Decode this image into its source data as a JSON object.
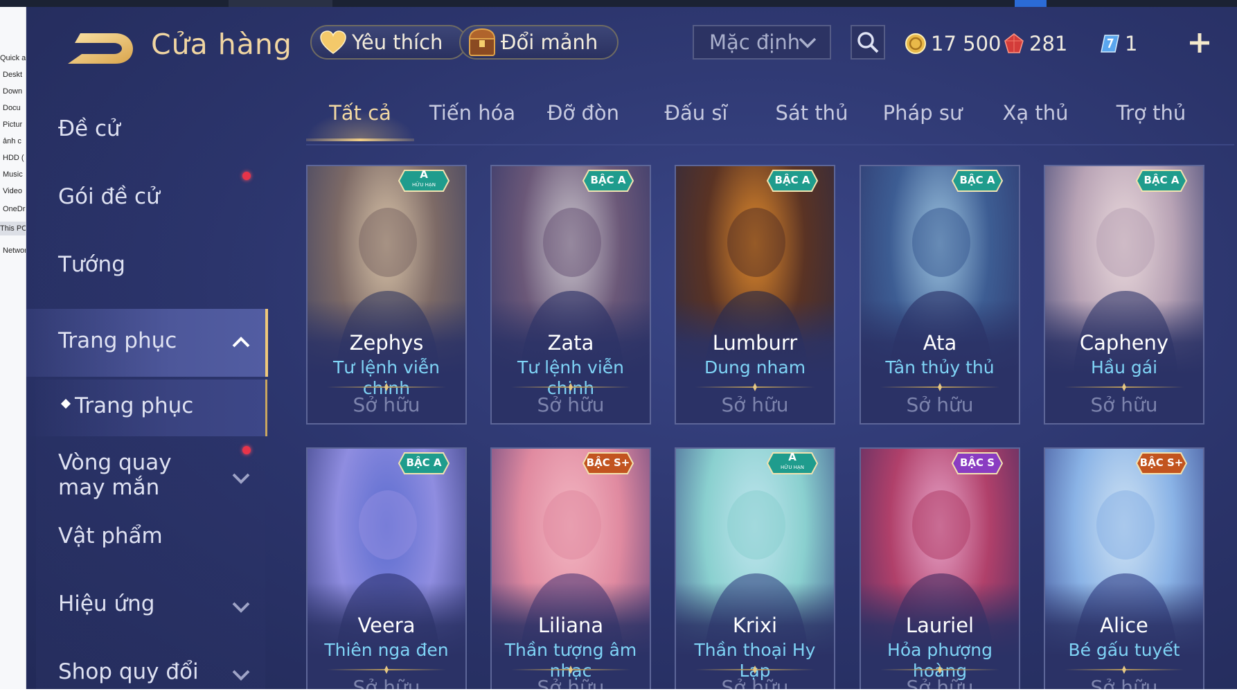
{
  "explorer": {
    "items": [
      "Quick a",
      "Deskt",
      "Down",
      "Docu",
      "Pictur",
      "ảnh c",
      "HDD (",
      "Music",
      "Video",
      "OneDri",
      "This PC",
      "Networ"
    ],
    "selected": "This PC"
  },
  "header": {
    "title": "Cửa hàng",
    "favorites_label": "Yêu thích",
    "shards_label": "Đổi mảnh",
    "sort_selected": "Mặc định",
    "gold": "17 500",
    "gems": "281",
    "vouchers": "1"
  },
  "sidebar": {
    "items": [
      {
        "label": "Đề cử"
      },
      {
        "label": "Gói đề cử"
      },
      {
        "label": "Tướng"
      },
      {
        "label": "Trang phục"
      },
      {
        "label": "Trang phục"
      },
      {
        "label": "Vòng quay may mắn"
      },
      {
        "label": "Vật phẩm"
      },
      {
        "label": "Hiệu ứng"
      },
      {
        "label": "Shop quy đổi"
      }
    ]
  },
  "tabs": [
    {
      "label": "Tất cả",
      "active": true
    },
    {
      "label": "Tiến hóa"
    },
    {
      "label": "Đỡ đòn"
    },
    {
      "label": "Đấu sĩ"
    },
    {
      "label": "Sát thủ"
    },
    {
      "label": "Pháp sư"
    },
    {
      "label": "Xạ thủ"
    },
    {
      "label": "Trợ thủ"
    }
  ],
  "cards": [
    {
      "hero": "Zephys",
      "skin": "Tư lệnh viễn chinh",
      "status": "Sở hữu",
      "badge": "A",
      "badge_sub": "HỮU HẠN",
      "badge_color": "#1f9c8d"
    },
    {
      "hero": "Zata",
      "skin": "Tư lệnh viễn chinh",
      "status": "Sở hữu",
      "badge": "BẬC A",
      "badge_color": "#1f9c8d"
    },
    {
      "hero": "Lumburr",
      "skin": "Dung nham",
      "status": "Sở hữu",
      "badge": "BẬC A",
      "badge_color": "#1f9c8d"
    },
    {
      "hero": "Ata",
      "skin": "Tân thủy thủ",
      "status": "Sở hữu",
      "badge": "BẬC A",
      "badge_color": "#1f9c8d"
    },
    {
      "hero": "Capheny",
      "skin": "Hầu gái",
      "status": "Sở hữu",
      "badge": "BẬC A",
      "badge_color": "#1f9c8d"
    },
    {
      "hero": "Veera",
      "skin": "Thiên nga đen",
      "status": "Sở hữu",
      "badge": "BẬC A",
      "badge_color": "#1f9c8d"
    },
    {
      "hero": "Liliana",
      "skin": "Thần tượng âm nhạc",
      "status": "Sở hữu",
      "badge": "BẬC S+",
      "badge_color": "#c2541f"
    },
    {
      "hero": "Krixi",
      "skin": "Thần thoại Hy Lạp",
      "status": "Sở hữu",
      "badge": "A",
      "badge_sub": "HỮU HẠN",
      "badge_color": "#1f9c8d"
    },
    {
      "hero": "Lauriel",
      "skin": "Hỏa phượng hoàng",
      "status": "Sở hữu",
      "badge": "BẬC S",
      "badge_color": "#8a3cc2"
    },
    {
      "hero": "Alice",
      "skin": "Bé gấu tuyết",
      "status": "Sở hữu",
      "badge": "BẬC S+",
      "badge_color": "#c2541f"
    }
  ],
  "colors": {
    "accent_gold": "#f1d6a2",
    "skin_name_cyan": "#7fd4f6",
    "notification_red": "#e8344a"
  }
}
